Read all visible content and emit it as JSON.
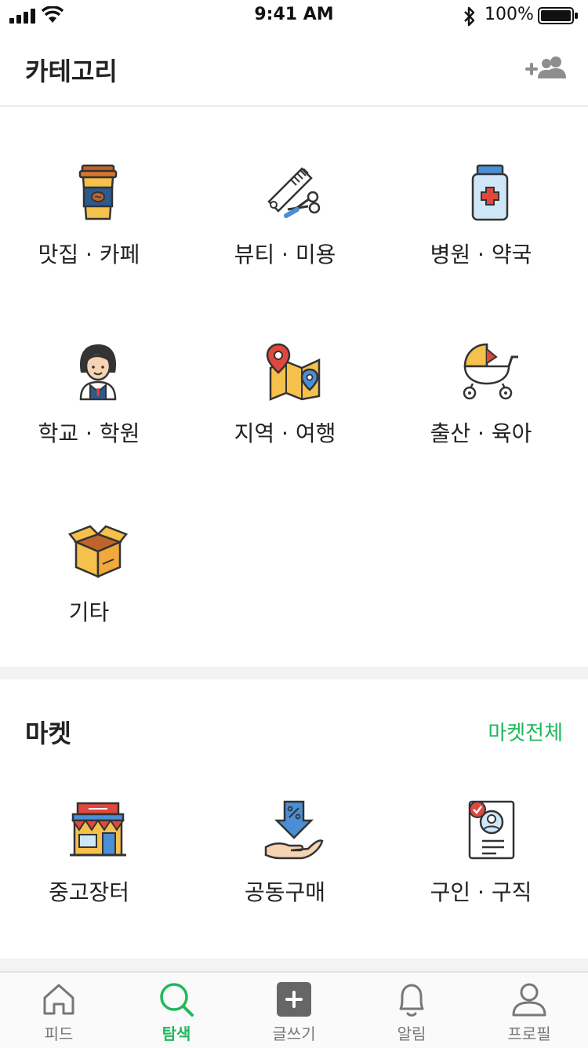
{
  "status_bar": {
    "time": "9:41 AM",
    "battery": "100%"
  },
  "header": {
    "title": "카테고리",
    "add_friend_icon": "add-friend-icon"
  },
  "categories": [
    {
      "label": "맛집 · 카페",
      "icon": "coffee-cup-icon"
    },
    {
      "label": "뷰티 · 미용",
      "icon": "comb-scissors-icon"
    },
    {
      "label": "병원 · 약국",
      "icon": "medicine-bottle-icon"
    },
    {
      "label": "학교 · 학원",
      "icon": "student-icon"
    },
    {
      "label": "지역 · 여행",
      "icon": "map-pin-icon"
    },
    {
      "label": "출산 · 육아",
      "icon": "stroller-icon"
    },
    {
      "label": "기타",
      "icon": "box-icon"
    }
  ],
  "market": {
    "title": "마켓",
    "see_all": "마켓전체",
    "items": [
      {
        "label": "중고장터",
        "icon": "store-icon"
      },
      {
        "label": "공동구매",
        "icon": "discount-hand-icon"
      },
      {
        "label": "구인 · 구직",
        "icon": "resume-icon"
      }
    ]
  },
  "tabs": [
    {
      "label": "피드",
      "icon": "home-icon",
      "active": false
    },
    {
      "label": "탐색",
      "icon": "search-icon",
      "active": true
    },
    {
      "label": "글쓰기",
      "icon": "write-icon",
      "active": false
    },
    {
      "label": "알림",
      "icon": "bell-icon",
      "active": false
    },
    {
      "label": "프로필",
      "icon": "profile-icon",
      "active": false
    }
  ],
  "colors": {
    "accent": "#1fb85a",
    "divider": "#f3f3f3"
  }
}
